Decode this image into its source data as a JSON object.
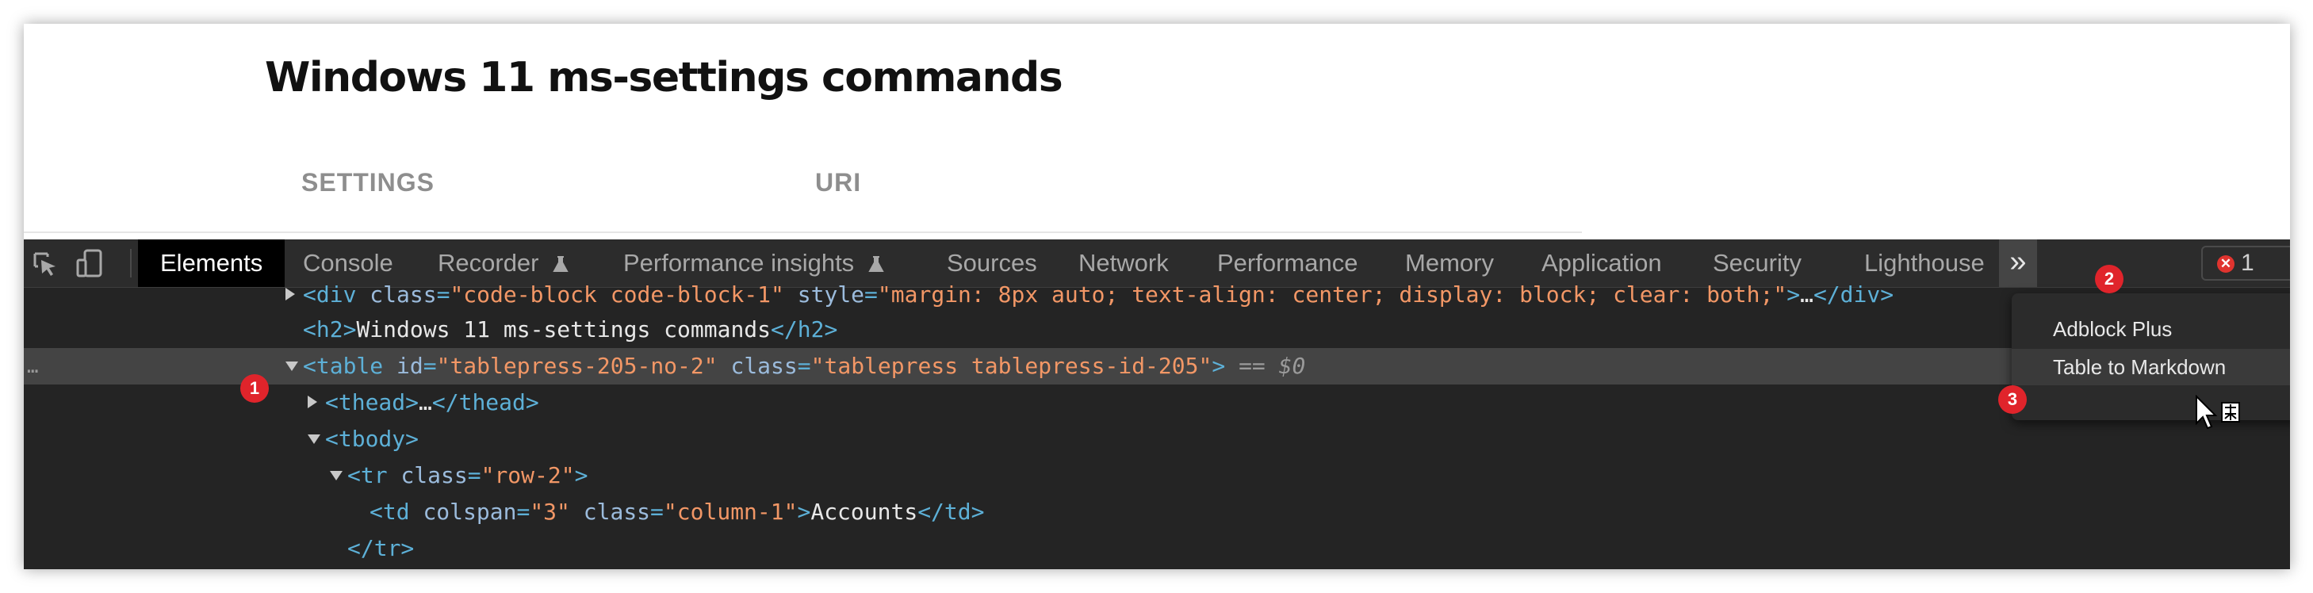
{
  "page": {
    "title": "Windows 11 ms-settings commands",
    "table_headers": [
      "SETTINGS",
      "URI"
    ]
  },
  "devtools": {
    "tabs": [
      "Elements",
      "Console",
      "Recorder",
      "Performance insights",
      "Sources",
      "Network",
      "Performance",
      "Memory",
      "Application",
      "Security",
      "Lighthouse"
    ],
    "active_tab": "Elements",
    "more_tabs_symbol": "»",
    "error_badge": {
      "icon": "✕",
      "count": "1"
    },
    "icons": [
      "inspect-icon",
      "device-toolbar-icon",
      "flask-icon"
    ],
    "code_lines": [
      {
        "parts": [
          {
            "t": "tg",
            "v": "<div "
          },
          {
            "t": "an",
            "v": "class"
          },
          {
            "t": "tg",
            "v": "="
          },
          {
            "t": "av",
            "v": "\"code-block code-block-1\""
          },
          {
            "t": "an",
            "v": " style"
          },
          {
            "t": "tg",
            "v": "="
          },
          {
            "t": "av",
            "v": "\"margin: 8px auto; text-align: center; display: block; clear: both;\""
          },
          {
            "t": "tg",
            "v": ">"
          },
          {
            "t": "tx",
            "v": "…"
          },
          {
            "t": "tg",
            "v": "</div>"
          }
        ]
      },
      {
        "parts": [
          {
            "t": "tg",
            "v": "<h2>"
          },
          {
            "t": "tx",
            "v": "Windows 11 ms-settings commands"
          },
          {
            "t": "tg",
            "v": "</h2>"
          }
        ]
      },
      {
        "parts": [
          {
            "t": "tg",
            "v": "<table "
          },
          {
            "t": "an",
            "v": "id"
          },
          {
            "t": "tg",
            "v": "="
          },
          {
            "t": "av",
            "v": "\"tablepress-205-no-2\""
          },
          {
            "t": "an",
            "v": " class"
          },
          {
            "t": "tg",
            "v": "="
          },
          {
            "t": "av",
            "v": "\"tablepress tablepress-id-205\""
          },
          {
            "t": "tg",
            "v": ">"
          },
          {
            "t": "gr",
            "v": " == $0"
          }
        ]
      },
      {
        "parts": [
          {
            "t": "tg",
            "v": "<thead>"
          },
          {
            "t": "tx",
            "v": "…"
          },
          {
            "t": "tg",
            "v": "</thead>"
          }
        ]
      },
      {
        "parts": [
          {
            "t": "tg",
            "v": "<tbody>"
          }
        ]
      },
      {
        "parts": [
          {
            "t": "tg",
            "v": "<tr "
          },
          {
            "t": "an",
            "v": "class"
          },
          {
            "t": "tg",
            "v": "="
          },
          {
            "t": "av",
            "v": "\"row-2\""
          },
          {
            "t": "tg",
            "v": ">"
          }
        ]
      },
      {
        "parts": [
          {
            "t": "tg",
            "v": "<td "
          },
          {
            "t": "an",
            "v": "colspan"
          },
          {
            "t": "tg",
            "v": "="
          },
          {
            "t": "av",
            "v": "\"3\""
          },
          {
            "t": "an",
            "v": " class"
          },
          {
            "t": "tg",
            "v": "="
          },
          {
            "t": "av",
            "v": "\"column-1\""
          },
          {
            "t": "tg",
            "v": ">"
          },
          {
            "t": "tx",
            "v": "Accounts"
          },
          {
            "t": "tg",
            "v": "</td>"
          }
        ]
      },
      {
        "parts": [
          {
            "t": "tg",
            "v": "</tr>"
          }
        ]
      }
    ],
    "selected_line_handle": "…",
    "overflow_menu": {
      "items": [
        "Adblock Plus",
        "Table to Markdown"
      ],
      "hovered": "Table to Markdown"
    }
  },
  "annotations": {
    "badges": [
      "1",
      "2",
      "3"
    ],
    "color": "#e0242b"
  }
}
